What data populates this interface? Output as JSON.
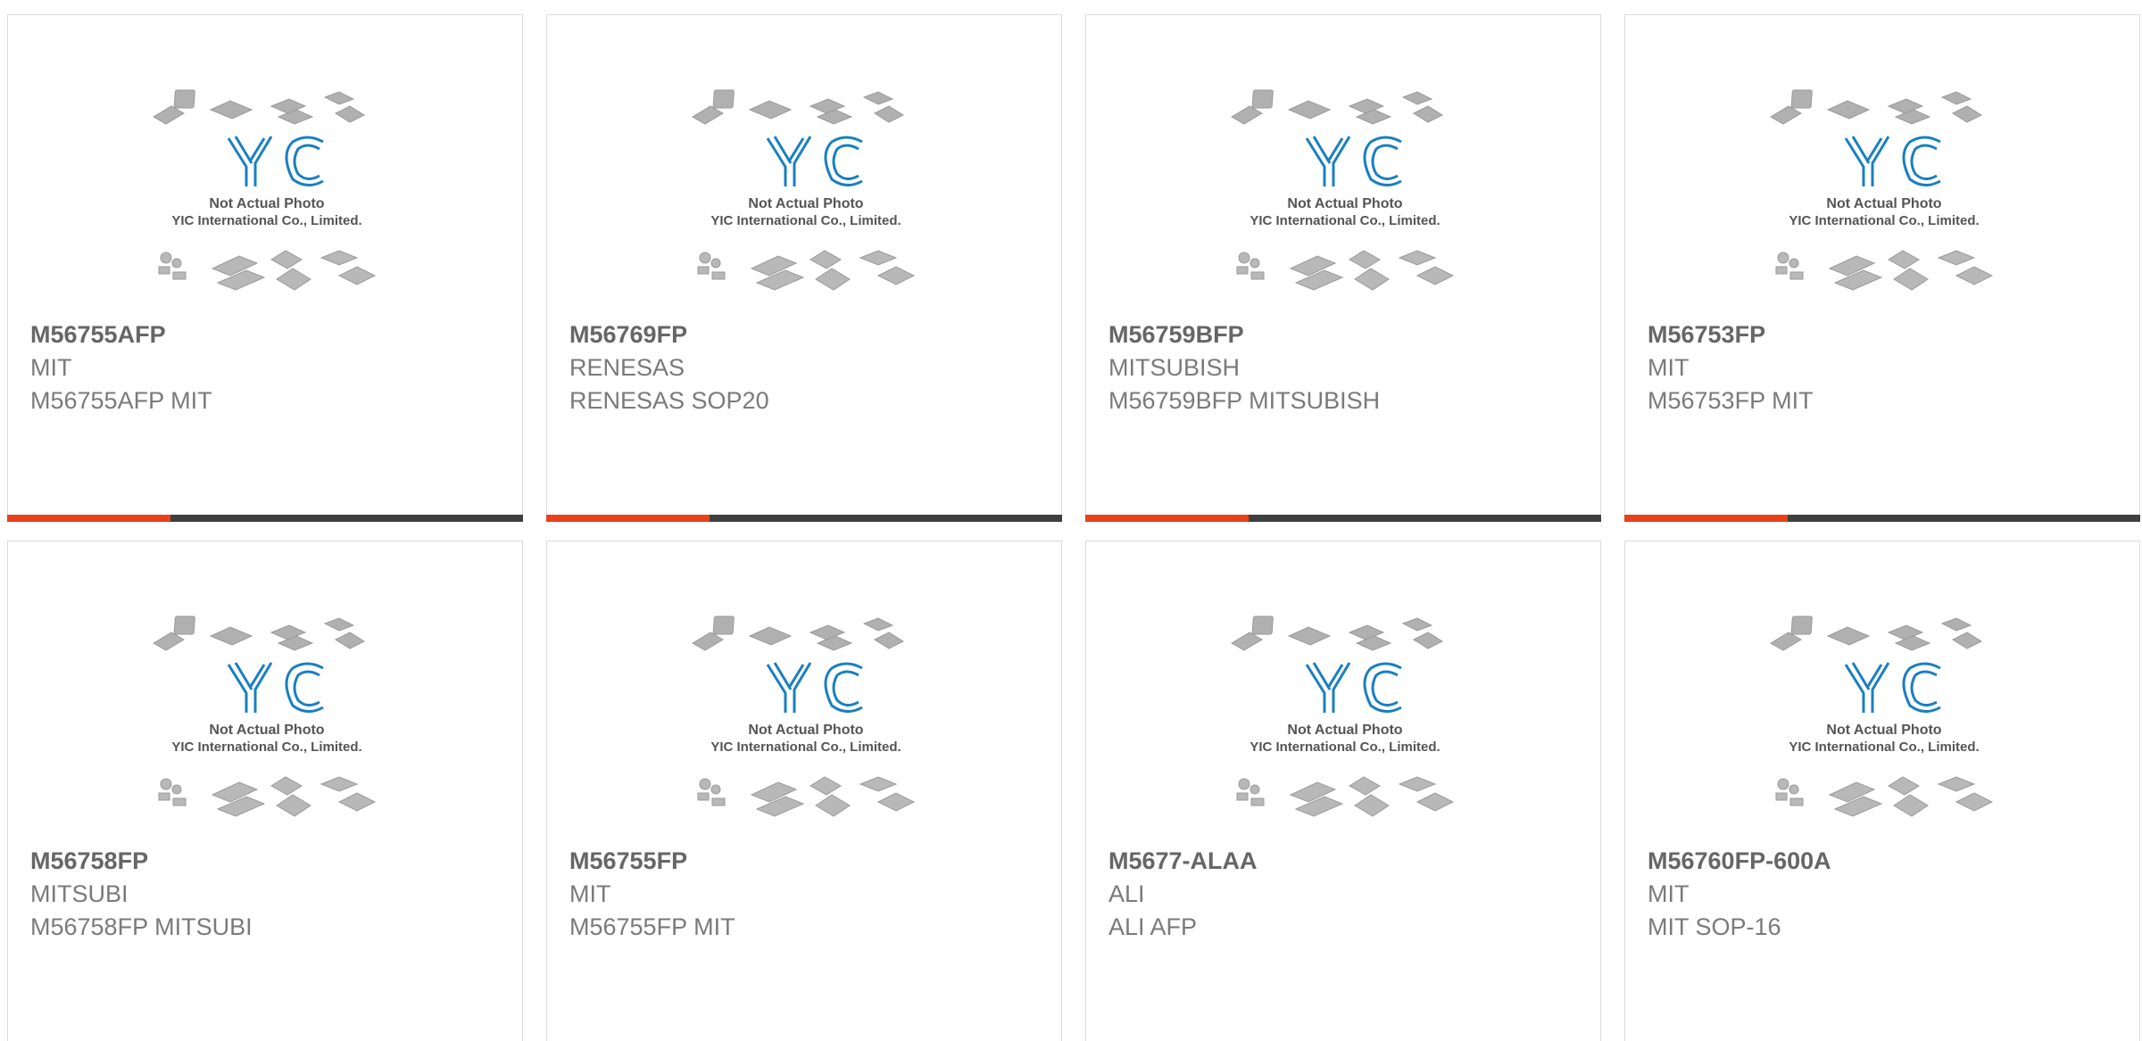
{
  "placeholder": {
    "line1": "Not Actual Photo",
    "line2": "YIC International Co., Limited.",
    "logo": "YIC"
  },
  "colors": {
    "accent": "#e8411a",
    "bar": "#3f3f3f",
    "logo_blue": "#1a7fc1",
    "text_strong": "#666666",
    "text": "#7a7a7a"
  },
  "products": [
    {
      "part_number": "M56755AFP",
      "brand": "MIT",
      "description": "M56755AFP MIT"
    },
    {
      "part_number": "M56769FP",
      "brand": "RENESAS",
      "description": "RENESAS SOP20"
    },
    {
      "part_number": "M56759BFP",
      "brand": "MITSUBISH",
      "description": "M56759BFP MITSUBISH"
    },
    {
      "part_number": "M56753FP",
      "brand": "MIT",
      "description": "M56753FP MIT"
    },
    {
      "part_number": "M56758FP",
      "brand": "MITSUBI",
      "description": "M56758FP MITSUBI"
    },
    {
      "part_number": "M56755FP",
      "brand": "MIT",
      "description": "M56755FP MIT"
    },
    {
      "part_number": "M5677-ALAA",
      "brand": "ALI",
      "description": "ALI AFP"
    },
    {
      "part_number": "M56760FP-600A",
      "brand": "MIT",
      "description": "MIT SOP-16"
    }
  ]
}
